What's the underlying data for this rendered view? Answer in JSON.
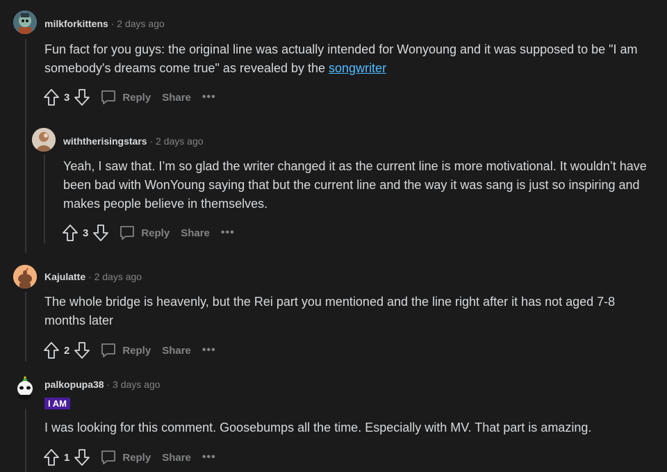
{
  "comments": [
    {
      "username": "milkforkittens",
      "time": "2 days ago",
      "text": "Fun fact for you guys: the original line was actually intended for Wonyoung and it was supposed to be \"I am somebody's dreams come true\" as revealed by the ",
      "link": "songwriter",
      "votes": "3",
      "reply": "Reply",
      "share": "Share",
      "more": "•••"
    },
    {
      "username": "withtherisingstars",
      "time": "2 days ago",
      "text": "Yeah, I saw that. I’m so glad the writer changed it as the current line is more motivational. It wouldn’t have been bad with WonYoung saying that but the current line and the way it was sang is just so inspiring and makes people believe in themselves.",
      "votes": "3",
      "reply": "Reply",
      "share": "Share",
      "more": "•••"
    },
    {
      "username": "Kajulatte",
      "time": "2 days ago",
      "text": "The whole bridge is heavenly, but the Rei part you mentioned and the line right after it has not aged 7-8 months later",
      "votes": "2",
      "reply": "Reply",
      "share": "Share",
      "more": "•••"
    },
    {
      "username": "palkopupa38",
      "time": "3 days ago",
      "flair": "I AM",
      "text": "I was looking for this comment. Goosebumps all the time. Especially with MV. That part is amazing.",
      "votes": "1",
      "reply": "Reply",
      "share": "Share",
      "more": "•••"
    }
  ],
  "separator": "·",
  "colors": {
    "background": "#1b1b1c",
    "link": "#4fbcff",
    "flair_bg": "#4a1e9e",
    "muted": "#818384"
  }
}
